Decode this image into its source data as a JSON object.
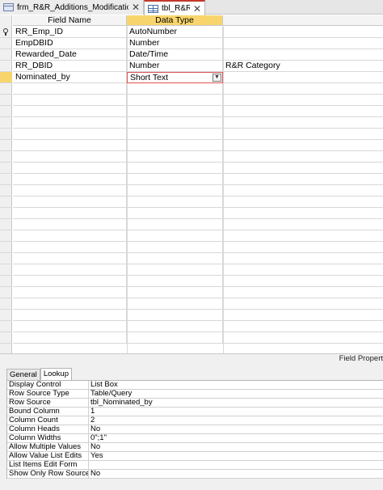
{
  "tabs": [
    {
      "label": "frm_R&R_Additions_Modifications",
      "icon": "form-icon",
      "active": false
    },
    {
      "label": "tbl_R&R",
      "icon": "table-icon",
      "active": true
    }
  ],
  "grid": {
    "headers": {
      "field_name": "Field Name",
      "data_type": "Data Type",
      "description": ""
    },
    "rows": [
      {
        "field": "RR_Emp_ID",
        "type": "AutoNumber",
        "description": "",
        "primary_key": true
      },
      {
        "field": "EmpDBID",
        "type": "Number",
        "description": ""
      },
      {
        "field": "Rewarded_Date",
        "type": "Date/Time",
        "description": ""
      },
      {
        "field": "RR_DBID",
        "type": "Number",
        "description": "R&R Category"
      },
      {
        "field": "Nominated_by",
        "type": "Short Text",
        "description": "",
        "current": true
      }
    ],
    "selected_color": "#f7d56c"
  },
  "field_properties_label": "Field Propert",
  "property_sheet": {
    "tabs": [
      "General",
      "Lookup"
    ],
    "active_tab": "Lookup",
    "rows": [
      {
        "label": "Display Control",
        "value": "List Box"
      },
      {
        "label": "Row Source Type",
        "value": "Table/Query"
      },
      {
        "label": "Row Source",
        "value": "tbl_Nominated_by"
      },
      {
        "label": "Bound Column",
        "value": "1"
      },
      {
        "label": "Column Count",
        "value": "2"
      },
      {
        "label": "Column Heads",
        "value": "No"
      },
      {
        "label": "Column Widths",
        "value": "0\";1\""
      },
      {
        "label": "Allow Multiple Values",
        "value": "No"
      },
      {
        "label": "Allow Value List Edits",
        "value": "Yes"
      },
      {
        "label": "List Items Edit Form",
        "value": ""
      },
      {
        "label": "Show Only Row Source V",
        "value": "No"
      }
    ]
  }
}
